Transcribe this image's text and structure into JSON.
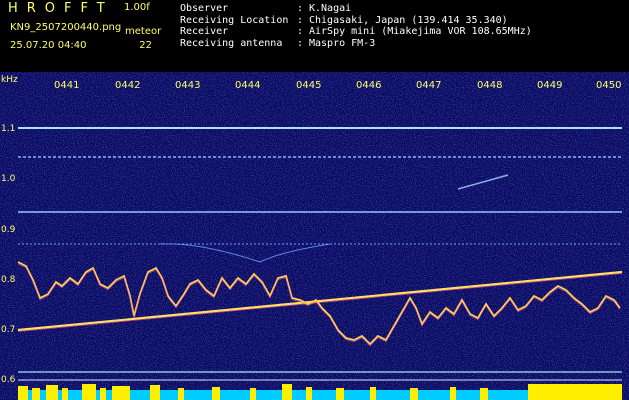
{
  "header": {
    "app_title": "HROFFT",
    "version": "1.00f",
    "filename": "KN9_2507200440.png",
    "meteor_label": "meteor",
    "datetime": "25.07.20 04:40",
    "meteor_count": "22"
  },
  "info": [
    {
      "key": "Observer",
      "sep": ":",
      "value": "K.Nagai"
    },
    {
      "key": "Receiving Location",
      "sep": ":",
      "value": "Chigasaki, Japan (139.414 35.340)"
    },
    {
      "key": "Receiver",
      "sep": ":",
      "value": "AirSpy mini (Miakejima VOR 108.65MHz)"
    },
    {
      "key": "Receiving antenna",
      "sep": ":",
      "value": "Maspro FM-3"
    }
  ],
  "spectrogram": {
    "unit_label": "kHz",
    "time_ticks": [
      "0441",
      "0442",
      "0443",
      "0444",
      "0445",
      "0446",
      "0447",
      "0448",
      "0449",
      "0450"
    ],
    "freq_labels": [
      "1.1",
      "1.0",
      "0.9",
      "0.8",
      "0.7",
      "0.6"
    ],
    "colors": {
      "background": "#0a0a60",
      "noise": "#3344cc",
      "carrier": "#9fd8ff",
      "tick_text": "#ffff66",
      "baseline_bar": "#00ccff",
      "activity": "#ffee00"
    }
  }
}
